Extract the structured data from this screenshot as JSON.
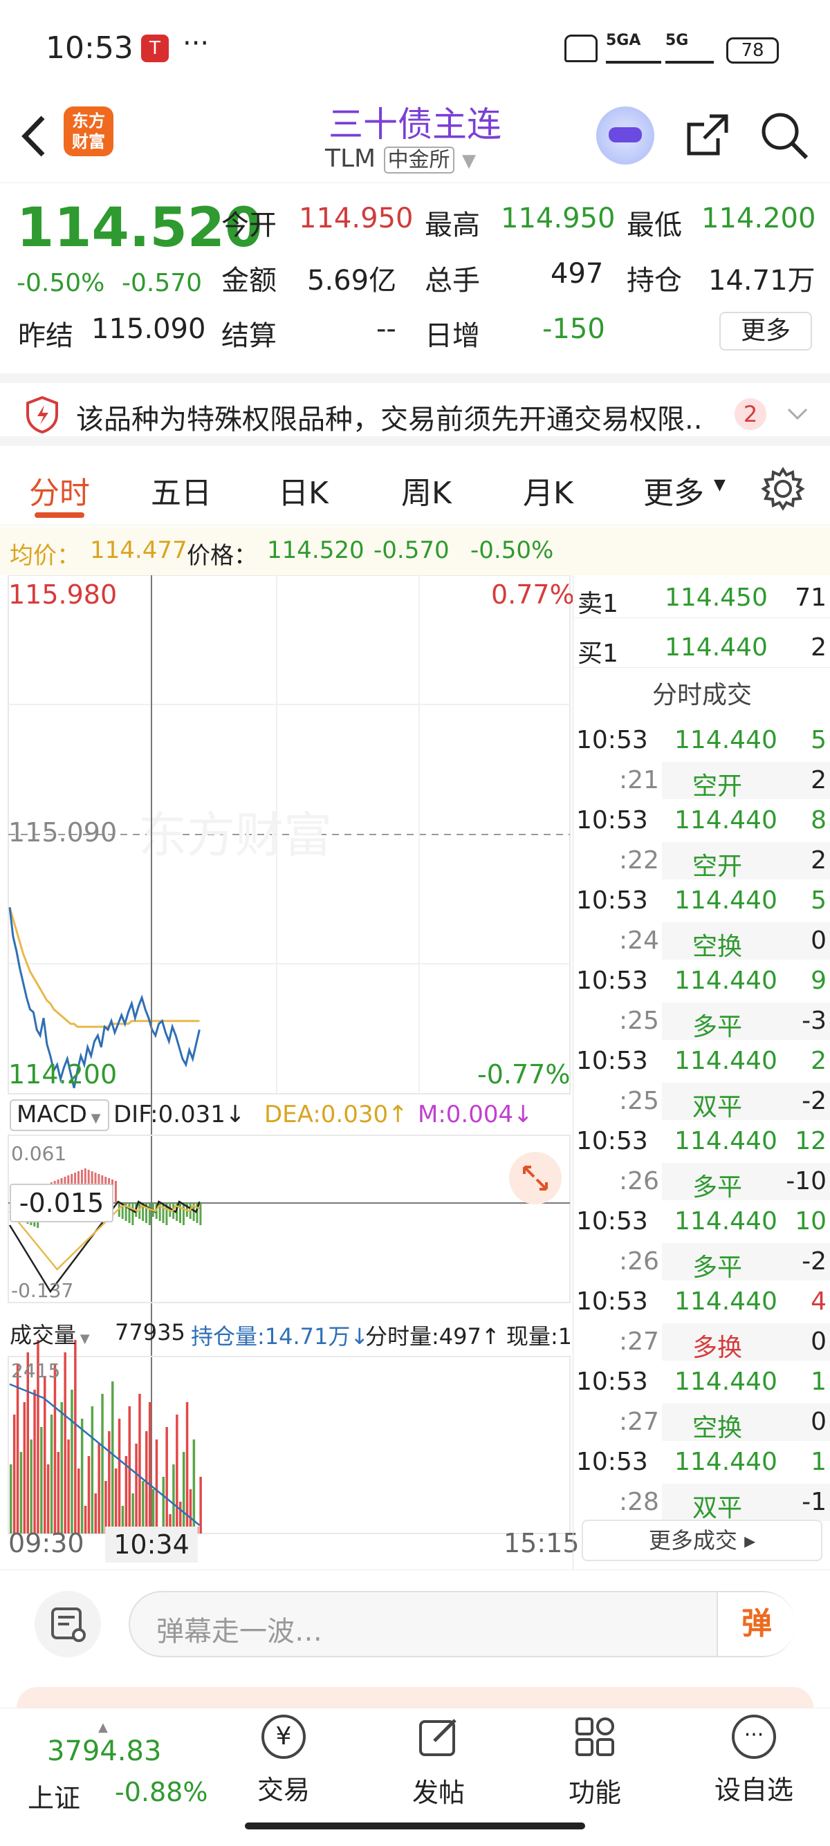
{
  "status_bar": {
    "time": "10:53",
    "more": "···",
    "signal1": "5GA",
    "signal2": "5G",
    "battery": "78"
  },
  "header": {
    "logo_line1": "东方",
    "logo_line2": "财富",
    "title": "三十债主连",
    "code": "TLM",
    "exchange": "中金所"
  },
  "quote": {
    "price": "114.520",
    "change_pct": "-0.50%",
    "change": "-0.570",
    "prev_settle_label": "昨结",
    "prev_settle": "115.090",
    "open_label": "今开",
    "open": "114.950",
    "high_label": "最高",
    "high": "114.950",
    "low_label": "最低",
    "low": "114.200",
    "amount_label": "金额",
    "amount": "5.69亿",
    "volume_label": "总手",
    "volume": "497",
    "oi_label": "持仓",
    "oi": "14.71万",
    "settle_label": "结算",
    "settle": "--",
    "daily_inc_label": "日增",
    "daily_inc": "-150",
    "more_button": "更多"
  },
  "notice": {
    "text": "该品种为特殊权限品种，交易前须先开通交易权限..",
    "count": "2"
  },
  "tabs": [
    "分时",
    "五日",
    "日K",
    "周K",
    "月K",
    "更多"
  ],
  "info_line": {
    "avg_label": "均价：",
    "avg": "114.477",
    "price_label": "价格：",
    "price": "114.520",
    "change": "-0.570",
    "pct": "-0.50%"
  },
  "chart": {
    "top_price": "115.980",
    "top_pct": "0.77%",
    "mid_price": "115.090",
    "bottom_price": "114.200",
    "bottom_pct": "-0.77%",
    "watermark": "东方财富",
    "macd_label": "MACD",
    "dif": "DIF:0.031↓",
    "dea": "DEA:0.030↑",
    "m": "M:0.004↓",
    "macd_top": "0.061",
    "macd_bottom": "-0.137",
    "macd_cursor": "-0.015",
    "vol_label": "成交量",
    "vol_value": "77935",
    "oi_label": "持仓量:14.71万↓",
    "tick_vol": "分时量:497↑",
    "now_vol": "现量:1",
    "vol_top": "2415",
    "time_start": "09:30",
    "time_cursor": "10:34",
    "time_end": "15:15"
  },
  "chart_data": {
    "type": "line",
    "price_series": [
      114.84,
      114.74,
      114.69,
      114.63,
      114.58,
      114.53,
      114.49,
      114.48,
      114.42,
      114.4,
      114.46,
      114.37,
      114.33,
      114.28,
      114.3,
      114.25,
      114.29,
      114.32,
      114.27,
      114.22,
      114.28,
      114.33,
      114.3,
      114.36,
      114.33,
      114.38,
      114.4,
      114.36,
      114.43,
      114.42,
      114.45,
      114.41,
      114.44,
      114.47,
      114.44,
      114.48,
      114.51,
      114.46,
      114.5,
      114.53,
      114.49,
      114.46,
      114.42,
      114.4,
      114.44,
      114.45,
      114.41,
      114.38,
      114.43,
      114.4,
      114.36,
      114.32,
      114.3,
      114.35,
      114.32,
      114.37,
      114.42
    ],
    "avg_series": [
      114.84,
      114.8,
      114.76,
      114.72,
      114.68,
      114.65,
      114.62,
      114.6,
      114.58,
      114.56,
      114.54,
      114.52,
      114.51,
      114.49,
      114.48,
      114.47,
      114.46,
      114.45,
      114.44,
      114.44,
      114.43,
      114.43,
      114.43,
      114.43,
      114.43,
      114.43,
      114.43,
      114.43,
      114.43,
      114.43,
      114.44,
      114.44,
      114.44,
      114.44,
      114.44,
      114.44,
      114.45,
      114.45,
      114.45,
      114.45,
      114.45,
      114.45,
      114.45,
      114.45,
      114.45,
      114.45,
      114.45,
      114.45,
      114.45,
      114.45,
      114.45,
      114.45,
      114.45,
      114.45,
      114.45,
      114.45,
      114.45
    ]
  },
  "order_book": {
    "ask_label": "卖1",
    "ask_price": "114.450",
    "ask_vol": "71",
    "bid_label": "买1",
    "bid_price": "114.440",
    "bid_vol": "2",
    "ticks_title": "分时成交",
    "ticks": [
      {
        "time": "10:53",
        "price": "114.440",
        "vol": "5",
        "sec": ":21",
        "type": "空开",
        "oi": "2",
        "type_color": "green",
        "vol_color": "green"
      },
      {
        "time": "10:53",
        "price": "114.440",
        "vol": "8",
        "sec": ":22",
        "type": "空开",
        "oi": "2",
        "type_color": "green",
        "vol_color": "green"
      },
      {
        "time": "10:53",
        "price": "114.440",
        "vol": "5",
        "sec": ":24",
        "type": "空换",
        "oi": "0",
        "type_color": "green",
        "vol_color": "green"
      },
      {
        "time": "10:53",
        "price": "114.440",
        "vol": "9",
        "sec": ":25",
        "type": "多平",
        "oi": "-3",
        "type_color": "green",
        "vol_color": "green"
      },
      {
        "time": "10:53",
        "price": "114.440",
        "vol": "2",
        "sec": ":25",
        "type": "双平",
        "oi": "-2",
        "type_color": "green",
        "vol_color": "green"
      },
      {
        "time": "10:53",
        "price": "114.440",
        "vol": "12",
        "sec": ":26",
        "type": "多平",
        "oi": "-10",
        "type_color": "green",
        "vol_color": "green"
      },
      {
        "time": "10:53",
        "price": "114.440",
        "vol": "10",
        "sec": ":26",
        "type": "多平",
        "oi": "-2",
        "type_color": "green",
        "vol_color": "green"
      },
      {
        "time": "10:53",
        "price": "114.440",
        "vol": "4",
        "sec": ":27",
        "type": "多换",
        "oi": "0",
        "type_color": "red",
        "vol_color": "red"
      },
      {
        "time": "10:53",
        "price": "114.440",
        "vol": "1",
        "sec": ":27",
        "type": "空换",
        "oi": "0",
        "type_color": "green",
        "vol_color": "green"
      },
      {
        "time": "10:53",
        "price": "114.440",
        "vol": "1",
        "sec": ":28",
        "type": "双平",
        "oi": "-1",
        "type_color": "green",
        "vol_color": "green"
      }
    ],
    "more_button": "更多成交"
  },
  "comment": {
    "placeholder": "弹幕走一波…",
    "send": "弹"
  },
  "bottom": {
    "index_value": "3794.83",
    "index_name": "上证",
    "index_pct": "-0.88%",
    "trade": "交易",
    "post": "发帖",
    "func": "功能",
    "watch": "设自选"
  }
}
